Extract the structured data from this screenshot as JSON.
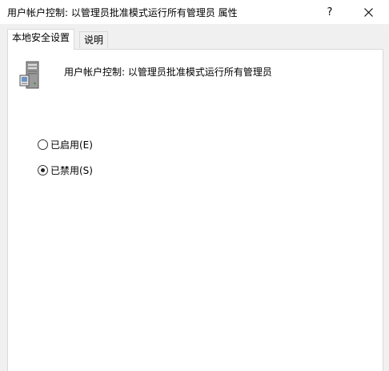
{
  "window": {
    "title": "用户帐户控制: 以管理员批准模式运行所有管理员 属性",
    "help_glyph": "?",
    "close_glyph": "✕"
  },
  "tabs": [
    {
      "label": "本地安全设置",
      "active": true
    },
    {
      "label": "说明",
      "active": false
    }
  ],
  "policy": {
    "icon": "server-computer-icon",
    "name": "用户帐户控制: 以管理员批准模式运行所有管理员"
  },
  "options": [
    {
      "label": "已启用(E)",
      "checked": false
    },
    {
      "label": "已禁用(S)",
      "checked": true
    }
  ]
}
